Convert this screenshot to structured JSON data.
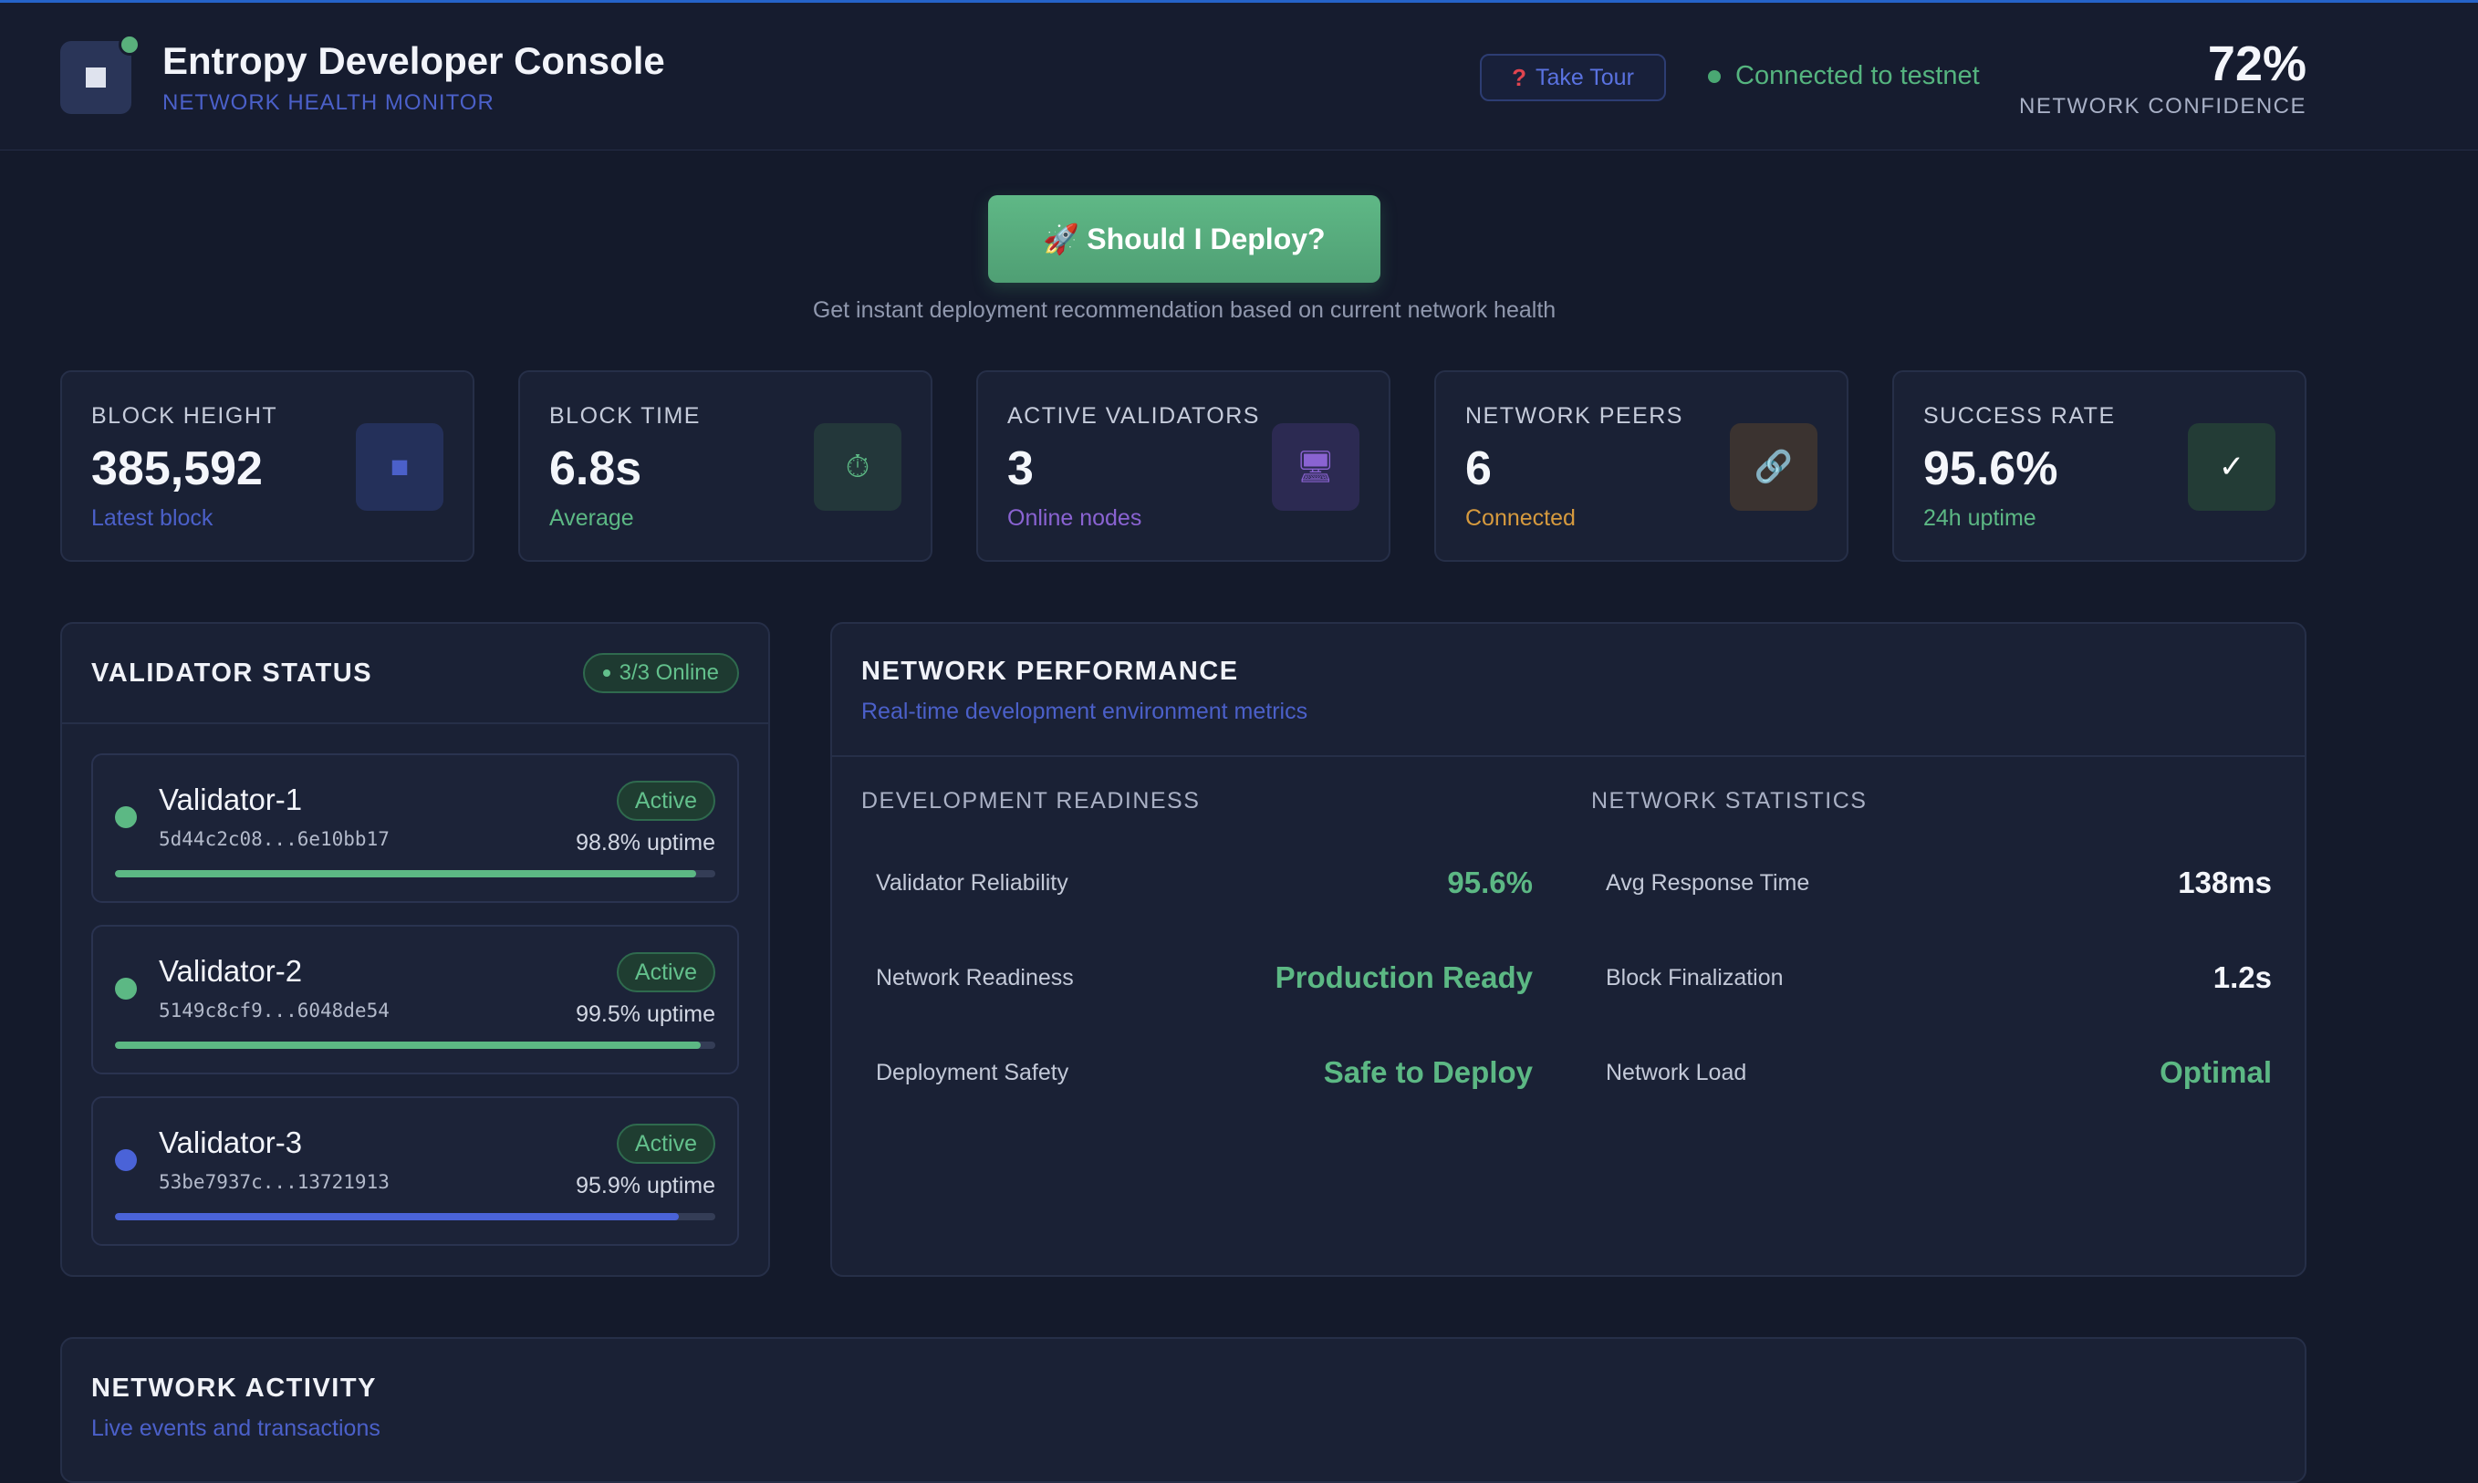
{
  "header": {
    "title": "Entropy Developer Console",
    "subtitle": "NETWORK HEALTH MONITOR",
    "tour_label": "Take Tour",
    "tour_icon": "?",
    "connection": "Connected to testnet",
    "confidence_value": "72%",
    "confidence_label": "NETWORK CONFIDENCE"
  },
  "deploy": {
    "label": "Should I Deploy?",
    "icon": "🚀",
    "description": "Get instant deployment recommendation based on current network health"
  },
  "stats": [
    {
      "label": "BLOCK HEIGHT",
      "value": "385,592",
      "sub": "Latest block",
      "icon": "square-icon",
      "glyph": "■",
      "color": "#4b60c9"
    },
    {
      "label": "BLOCK TIME",
      "value": "6.8s",
      "sub": "Average",
      "icon": "stopwatch-icon",
      "glyph": "⏱",
      "color": "#5cb884"
    },
    {
      "label": "ACTIVE VALIDATORS",
      "value": "3",
      "sub": "Online nodes",
      "icon": "server-icon",
      "glyph": "🖥",
      "color": "#8a63d2"
    },
    {
      "label": "NETWORK PEERS",
      "value": "6",
      "sub": "Connected",
      "icon": "link-icon",
      "glyph": "🔗",
      "color": "#d69a3e"
    },
    {
      "label": "SUCCESS RATE",
      "value": "95.6%",
      "sub": "24h uptime",
      "icon": "check-icon",
      "glyph": "✓",
      "color": "#5cb884"
    }
  ],
  "validators": {
    "title": "VALIDATOR STATUS",
    "badge": "3/3 Online",
    "items": [
      {
        "name": "Validator-1",
        "hash": "5d44c2c08...6e10bb17",
        "status": "Active",
        "uptime": "98.8% uptime",
        "uptime_pct": 98.8,
        "color": "#5cb884"
      },
      {
        "name": "Validator-2",
        "hash": "5149c8cf9...6048de54",
        "status": "Active",
        "uptime": "99.5% uptime",
        "uptime_pct": 99.5,
        "color": "#5cb884"
      },
      {
        "name": "Validator-3",
        "hash": "53be7937c...13721913",
        "status": "Active",
        "uptime": "95.9% uptime",
        "uptime_pct": 95.9,
        "color": "#4a63d8"
      }
    ]
  },
  "performance": {
    "title": "NETWORK PERFORMANCE",
    "subtitle": "Real-time development environment metrics",
    "readiness": {
      "heading": "DEVELOPMENT READINESS",
      "rows": [
        {
          "label": "Validator Reliability",
          "value": "95.6%"
        },
        {
          "label": "Network Readiness",
          "value": "Production Ready"
        },
        {
          "label": "Deployment Safety",
          "value": "Safe to Deploy"
        }
      ]
    },
    "statistics": {
      "heading": "NETWORK STATISTICS",
      "rows": [
        {
          "label": "Avg Response Time",
          "value": "138ms"
        },
        {
          "label": "Block Finalization",
          "value": "1.2s"
        },
        {
          "label": "Network Load",
          "value": "Optimal"
        }
      ]
    }
  },
  "activity": {
    "title": "NETWORK ACTIVITY",
    "subtitle": "Live events and transactions"
  }
}
